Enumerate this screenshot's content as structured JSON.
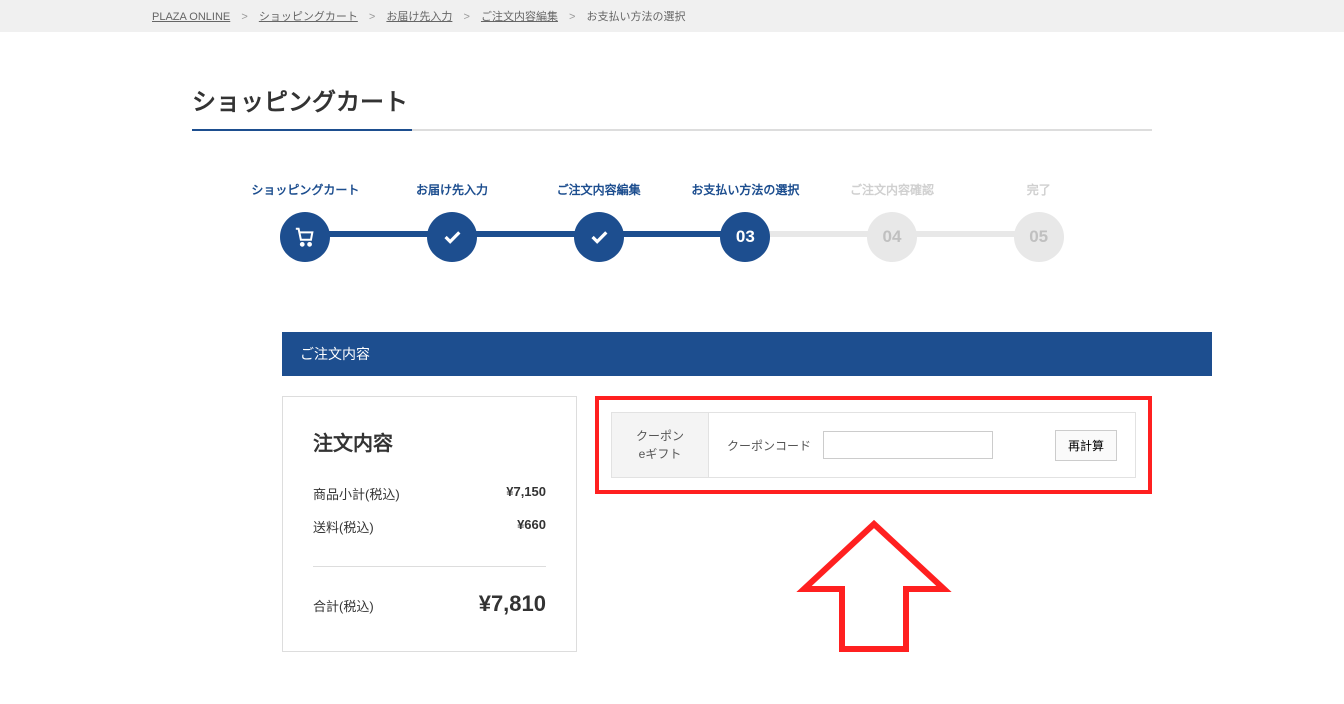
{
  "breadcrumb": {
    "items": [
      {
        "label": "PLAZA ONLINE"
      },
      {
        "label": "ショッピングカート"
      },
      {
        "label": "お届け先入力"
      },
      {
        "label": "ご注文内容編集"
      }
    ],
    "current": "お支払い方法の選択"
  },
  "page_title": "ショッピングカート",
  "progress": {
    "steps": [
      {
        "label": "ショッピングカート",
        "state": "done",
        "icon": "cart"
      },
      {
        "label": "お届け先入力",
        "state": "done",
        "icon": "check"
      },
      {
        "label": "ご注文内容編集",
        "state": "done",
        "icon": "check"
      },
      {
        "label": "お支払い方法の選択",
        "state": "current",
        "text": "03"
      },
      {
        "label": "ご注文内容確認",
        "state": "future",
        "text": "04"
      },
      {
        "label": "完了",
        "state": "future",
        "text": "05"
      }
    ]
  },
  "section_header": "ご注文内容",
  "order": {
    "title": "注文内容",
    "subtotal_label": "商品小計(税込)",
    "subtotal_value": "¥7,150",
    "shipping_label": "送料(税込)",
    "shipping_value": "¥660",
    "total_label": "合計(税込)",
    "total_value": "¥7,810"
  },
  "coupon": {
    "tab_line1": "クーポン",
    "tab_line2": "eギフト",
    "field_label": "クーポンコード",
    "input_value": "",
    "button_label": "再計算"
  },
  "colors": {
    "brand": "#1d4e8f",
    "highlight": "#ff2020"
  }
}
